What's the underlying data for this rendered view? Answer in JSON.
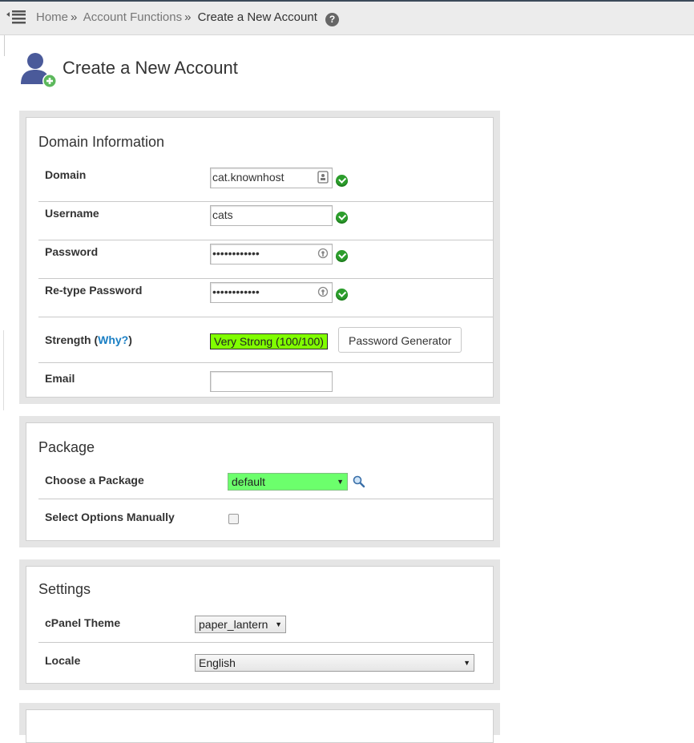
{
  "breadcrumb": {
    "items": [
      "Home",
      "Account Functions",
      "Create a New Account"
    ],
    "separator": "»"
  },
  "page": {
    "title": "Create a New Account"
  },
  "domain_info": {
    "title": "Domain Information",
    "domain": {
      "label": "Domain",
      "value": "cat.knownhost"
    },
    "username": {
      "label": "Username",
      "value": "cats"
    },
    "password": {
      "label": "Password",
      "value": "••••••••••••"
    },
    "retype_password": {
      "label": "Re-type Password",
      "value": "••••••••••••"
    },
    "strength": {
      "label_prefix": "Strength (",
      "why_link": "Why?",
      "label_suffix": ")",
      "value": "Very Strong (100/100)",
      "color": "#80ff00"
    },
    "password_generator_label": "Password Generator",
    "email": {
      "label": "Email",
      "value": ""
    }
  },
  "package": {
    "title": "Package",
    "choose_label": "Choose a Package",
    "selected": "default",
    "manual_label": "Select Options Manually",
    "manual_checked": false
  },
  "settings": {
    "title": "Settings",
    "theme_label": "cPanel Theme",
    "theme_value": "paper_lantern",
    "locale_label": "Locale",
    "locale_value": "English"
  },
  "icons": {
    "menu": "menu-collapse-icon",
    "help": "help-icon",
    "success": "check-circle-icon",
    "search": "magnifier-icon"
  },
  "colors": {
    "success": "#2c9d2c",
    "link": "#1a7fc4",
    "package_select": "#6cff6c"
  }
}
